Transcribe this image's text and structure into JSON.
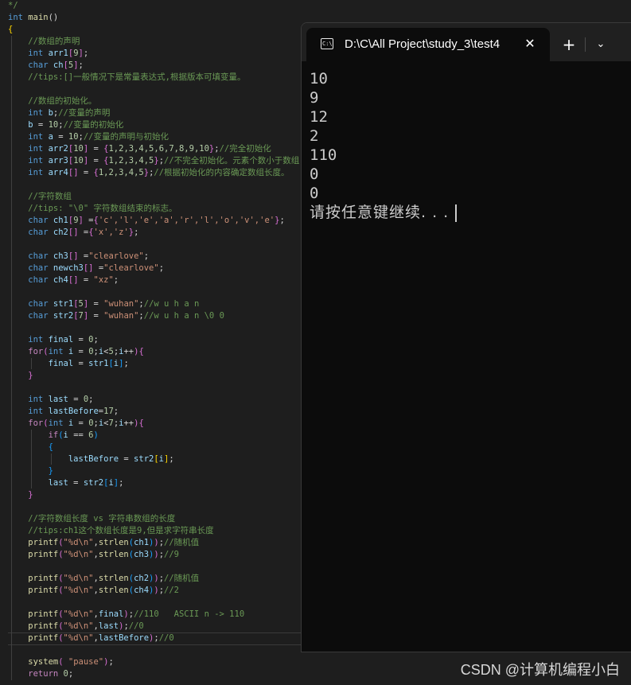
{
  "editor": {
    "lines": [
      [
        [
          "cm",
          "*/"
        ]
      ],
      [
        [
          "kw",
          "int "
        ],
        [
          "fn",
          "main"
        ],
        [
          "pu",
          "()"
        ]
      ],
      [
        [
          "br",
          "{"
        ]
      ],
      [
        [
          "cm",
          "    //数组的声明"
        ]
      ],
      [
        [
          "kw",
          "    int "
        ],
        [
          "id",
          "arr1"
        ],
        [
          "br2",
          "["
        ],
        [
          "nm",
          "9"
        ],
        [
          "br2",
          "]"
        ],
        [
          "pu",
          ";"
        ]
      ],
      [
        [
          "kw",
          "    char "
        ],
        [
          "id",
          "ch"
        ],
        [
          "br2",
          "["
        ],
        [
          "nm",
          "5"
        ],
        [
          "br2",
          "]"
        ],
        [
          "pu",
          ";"
        ]
      ],
      [
        [
          "cm",
          "    //tips:[]一般情况下是常量表达式,根据版本可填变量。"
        ]
      ],
      [],
      [
        [
          "cm",
          "    //数组的初始化。"
        ]
      ],
      [
        [
          "kw",
          "    int "
        ],
        [
          "id",
          "b"
        ],
        [
          "pu",
          ";"
        ],
        [
          "cm",
          "//变量的声明"
        ]
      ],
      [
        [
          "id",
          "    b"
        ],
        [
          "pu",
          " = "
        ],
        [
          "nm",
          "10"
        ],
        [
          "pu",
          ";"
        ],
        [
          "cm",
          "//变量的初始化"
        ]
      ],
      [
        [
          "kw",
          "    int "
        ],
        [
          "id",
          "a"
        ],
        [
          "pu",
          " = "
        ],
        [
          "nm",
          "10"
        ],
        [
          "pu",
          ";"
        ],
        [
          "cm",
          "//变量的声明与初始化"
        ]
      ],
      [
        [
          "kw",
          "    int "
        ],
        [
          "id",
          "arr2"
        ],
        [
          "br2",
          "["
        ],
        [
          "nm",
          "10"
        ],
        [
          "br2",
          "]"
        ],
        [
          "pu",
          " = "
        ],
        [
          "br2",
          "{"
        ],
        [
          "nm",
          "1,2,3,4,5,6,7,8,9,10"
        ],
        [
          "br2",
          "}"
        ],
        [
          "pu",
          ";"
        ],
        [
          "cm",
          "//完全初始化"
        ]
      ],
      [
        [
          "kw",
          "    int "
        ],
        [
          "id",
          "arr3"
        ],
        [
          "br2",
          "["
        ],
        [
          "nm",
          "10"
        ],
        [
          "br2",
          "]"
        ],
        [
          "pu",
          " = "
        ],
        [
          "br2",
          "{"
        ],
        [
          "nm",
          "1,2,3,4,5"
        ],
        [
          "br2",
          "}"
        ],
        [
          "pu",
          ";"
        ],
        [
          "cm",
          "//不完全初始化。元素个数小于数组"
        ]
      ],
      [
        [
          "kw",
          "    int "
        ],
        [
          "id",
          "arr4"
        ],
        [
          "br2",
          "[]"
        ],
        [
          "pu",
          " = "
        ],
        [
          "br2",
          "{"
        ],
        [
          "nm",
          "1,2,3,4,5"
        ],
        [
          "br2",
          "}"
        ],
        [
          "pu",
          ";"
        ],
        [
          "cm",
          "//根据初始化的内容确定数组长度。"
        ]
      ],
      [],
      [
        [
          "cm",
          "    //字符数组"
        ]
      ],
      [
        [
          "cm",
          "    //tips: \"\\0\" 字符数组结束的标志。"
        ]
      ],
      [
        [
          "kw",
          "    char "
        ],
        [
          "id",
          "ch1"
        ],
        [
          "br2",
          "["
        ],
        [
          "nm",
          "9"
        ],
        [
          "br2",
          "]"
        ],
        [
          "pu",
          " ="
        ],
        [
          "br2",
          "{"
        ],
        [
          "st",
          "'c','l','e','a','r','l','o','v','e'"
        ],
        [
          "br2",
          "}"
        ],
        [
          "pu",
          ";"
        ]
      ],
      [
        [
          "kw",
          "    char "
        ],
        [
          "id",
          "ch2"
        ],
        [
          "br2",
          "[]"
        ],
        [
          "pu",
          " ="
        ],
        [
          "br2",
          "{"
        ],
        [
          "st",
          "'x','z'"
        ],
        [
          "br2",
          "}"
        ],
        [
          "pu",
          ";"
        ]
      ],
      [],
      [
        [
          "kw",
          "    char "
        ],
        [
          "id",
          "ch3"
        ],
        [
          "br2",
          "[]"
        ],
        [
          "pu",
          " ="
        ],
        [
          "st",
          "\"clearlove\""
        ],
        [
          "pu",
          ";"
        ]
      ],
      [
        [
          "kw",
          "    char "
        ],
        [
          "id",
          "newch3"
        ],
        [
          "br2",
          "[]"
        ],
        [
          "pu",
          " ="
        ],
        [
          "st",
          "\"clearlove\""
        ],
        [
          "pu",
          ";"
        ]
      ],
      [
        [
          "kw",
          "    char "
        ],
        [
          "id",
          "ch4"
        ],
        [
          "br2",
          "[]"
        ],
        [
          "pu",
          " = "
        ],
        [
          "st",
          "\"xz\""
        ],
        [
          "pu",
          ";"
        ]
      ],
      [],
      [
        [
          "kw",
          "    char "
        ],
        [
          "id",
          "str1"
        ],
        [
          "br2",
          "["
        ],
        [
          "nm",
          "5"
        ],
        [
          "br2",
          "]"
        ],
        [
          "pu",
          " = "
        ],
        [
          "st",
          "\"wuhan\""
        ],
        [
          "pu",
          ";"
        ],
        [
          "cm",
          "//w u h a n"
        ]
      ],
      [
        [
          "kw",
          "    char "
        ],
        [
          "id",
          "str2"
        ],
        [
          "br2",
          "["
        ],
        [
          "nm",
          "7"
        ],
        [
          "br2",
          "]"
        ],
        [
          "pu",
          " = "
        ],
        [
          "st",
          "\"wuhan\""
        ],
        [
          "pu",
          ";"
        ],
        [
          "cm",
          "//w u h a n \\0 0"
        ]
      ],
      [],
      [
        [
          "kw",
          "    int "
        ],
        [
          "id",
          "final"
        ],
        [
          "pu",
          " = "
        ],
        [
          "nm",
          "0"
        ],
        [
          "pu",
          ";"
        ]
      ],
      [
        [
          "ctl",
          "    for"
        ],
        [
          "br2",
          "("
        ],
        [
          "kw",
          "int "
        ],
        [
          "id",
          "i"
        ],
        [
          "pu",
          " = "
        ],
        [
          "nm",
          "0"
        ],
        [
          "pu",
          ";"
        ],
        [
          "id",
          "i"
        ],
        [
          "pu",
          "<"
        ],
        [
          "nm",
          "5"
        ],
        [
          "pu",
          ";"
        ],
        [
          "id",
          "i"
        ],
        [
          "pu",
          "++"
        ],
        [
          "br2",
          ")"
        ],
        [
          "br2",
          "{"
        ]
      ],
      [
        [
          "id",
          "        final"
        ],
        [
          "pu",
          " = "
        ],
        [
          "id",
          "str1"
        ],
        [
          "br3",
          "["
        ],
        [
          "id",
          "i"
        ],
        [
          "br3",
          "]"
        ],
        [
          "pu",
          ";"
        ]
      ],
      [
        [
          "br2",
          "    }"
        ]
      ],
      [],
      [
        [
          "kw",
          "    int "
        ],
        [
          "id",
          "last"
        ],
        [
          "pu",
          " = "
        ],
        [
          "nm",
          "0"
        ],
        [
          "pu",
          ";"
        ]
      ],
      [
        [
          "kw",
          "    int "
        ],
        [
          "id",
          "lastBefore"
        ],
        [
          "pu",
          "="
        ],
        [
          "nm",
          "17"
        ],
        [
          "pu",
          ";"
        ]
      ],
      [
        [
          "ctl",
          "    for"
        ],
        [
          "br2",
          "("
        ],
        [
          "kw",
          "int "
        ],
        [
          "id",
          "i"
        ],
        [
          "pu",
          " = "
        ],
        [
          "nm",
          "0"
        ],
        [
          "pu",
          ";"
        ],
        [
          "id",
          "i"
        ],
        [
          "pu",
          "<"
        ],
        [
          "nm",
          "7"
        ],
        [
          "pu",
          ";"
        ],
        [
          "id",
          "i"
        ],
        [
          "pu",
          "++"
        ],
        [
          "br2",
          ")"
        ],
        [
          "br2",
          "{"
        ]
      ],
      [
        [
          "ctl",
          "        if"
        ],
        [
          "br3",
          "("
        ],
        [
          "id",
          "i"
        ],
        [
          "pu",
          " == "
        ],
        [
          "nm",
          "6"
        ],
        [
          "br3",
          ")"
        ]
      ],
      [
        [
          "br3",
          "        {"
        ]
      ],
      [
        [
          "id",
          "            lastBefore"
        ],
        [
          "pu",
          " = "
        ],
        [
          "id",
          "str2"
        ],
        [
          "br",
          "["
        ],
        [
          "id",
          "i"
        ],
        [
          "br",
          "]"
        ],
        [
          "pu",
          ";"
        ]
      ],
      [
        [
          "br3",
          "        }"
        ]
      ],
      [
        [
          "id",
          "        last"
        ],
        [
          "pu",
          " = "
        ],
        [
          "id",
          "str2"
        ],
        [
          "br3",
          "["
        ],
        [
          "id",
          "i"
        ],
        [
          "br3",
          "]"
        ],
        [
          "pu",
          ";"
        ]
      ],
      [
        [
          "br2",
          "    }"
        ]
      ],
      [],
      [
        [
          "cm",
          "    //字符数组长度 vs 字符串数组的长度"
        ]
      ],
      [
        [
          "cm",
          "    //tips:ch1这个数组长度是9,但是求字符串长度"
        ]
      ],
      [
        [
          "fn",
          "    printf"
        ],
        [
          "br2",
          "("
        ],
        [
          "st",
          "\"%d\\n\""
        ],
        [
          "pu",
          ","
        ],
        [
          "fn",
          "strlen"
        ],
        [
          "br3",
          "("
        ],
        [
          "id",
          "ch1"
        ],
        [
          "br3",
          ")"
        ],
        [
          "br2",
          ")"
        ],
        [
          "pu",
          ";"
        ],
        [
          "cm",
          "//随机值"
        ]
      ],
      [
        [
          "fn",
          "    printf"
        ],
        [
          "br2",
          "("
        ],
        [
          "st",
          "\"%d\\n\""
        ],
        [
          "pu",
          ","
        ],
        [
          "fn",
          "strlen"
        ],
        [
          "br3",
          "("
        ],
        [
          "id",
          "ch3"
        ],
        [
          "br3",
          ")"
        ],
        [
          "br2",
          ")"
        ],
        [
          "pu",
          ";"
        ],
        [
          "cm",
          "//9"
        ]
      ],
      [],
      [
        [
          "fn",
          "    printf"
        ],
        [
          "br2",
          "("
        ],
        [
          "st",
          "\"%d\\n\""
        ],
        [
          "pu",
          ","
        ],
        [
          "fn",
          "strlen"
        ],
        [
          "br3",
          "("
        ],
        [
          "id",
          "ch2"
        ],
        [
          "br3",
          ")"
        ],
        [
          "br2",
          ")"
        ],
        [
          "pu",
          ";"
        ],
        [
          "cm",
          "//随机值"
        ]
      ],
      [
        [
          "fn",
          "    printf"
        ],
        [
          "br2",
          "("
        ],
        [
          "st",
          "\"%d\\n\""
        ],
        [
          "pu",
          ","
        ],
        [
          "fn",
          "strlen"
        ],
        [
          "br3",
          "("
        ],
        [
          "id",
          "ch4"
        ],
        [
          "br3",
          ")"
        ],
        [
          "br2",
          ")"
        ],
        [
          "pu",
          ";"
        ],
        [
          "cm",
          "//2"
        ]
      ],
      [],
      [
        [
          "fn",
          "    printf"
        ],
        [
          "br2",
          "("
        ],
        [
          "st",
          "\"%d\\n\""
        ],
        [
          "pu",
          ","
        ],
        [
          "id",
          "final"
        ],
        [
          "br2",
          ")"
        ],
        [
          "pu",
          ";"
        ],
        [
          "cm",
          "//110   ASCII n -> 110"
        ]
      ],
      [
        [
          "fn",
          "    printf"
        ],
        [
          "br2",
          "("
        ],
        [
          "st",
          "\"%d\\n\""
        ],
        [
          "pu",
          ","
        ],
        [
          "id",
          "last"
        ],
        [
          "br2",
          ")"
        ],
        [
          "pu",
          ";"
        ],
        [
          "cm",
          "//0"
        ]
      ],
      [
        [
          "fn",
          "    printf"
        ],
        [
          "br2",
          "("
        ],
        [
          "st",
          "\"%d\\n\""
        ],
        [
          "pu",
          ","
        ],
        [
          "id",
          "lastBefore"
        ],
        [
          "br2",
          ")"
        ],
        [
          "pu",
          ";"
        ],
        [
          "cm",
          "//0"
        ]
      ],
      [],
      [
        [
          "fn",
          "    system"
        ],
        [
          "br2",
          "("
        ],
        [
          "st",
          " \"pause\""
        ],
        [
          "br2",
          ")"
        ],
        [
          "pu",
          ";"
        ]
      ],
      [
        [
          "ctl",
          "    return "
        ],
        [
          "nm",
          "0"
        ],
        [
          "pu",
          ";"
        ]
      ]
    ]
  },
  "terminal": {
    "tab_title": "D:\\C\\All Project\\study_3\\test4",
    "tab_icon_glyph": "C:\\",
    "close_glyph": "✕",
    "new_tab_glyph": "+",
    "dropdown_glyph": "⌄",
    "output": [
      "10",
      "9",
      "12",
      "2",
      "110",
      "0",
      "0"
    ],
    "pause_prompt": "请按任意键继续. . ."
  },
  "watermark": "CSDN @计算机编程小白"
}
